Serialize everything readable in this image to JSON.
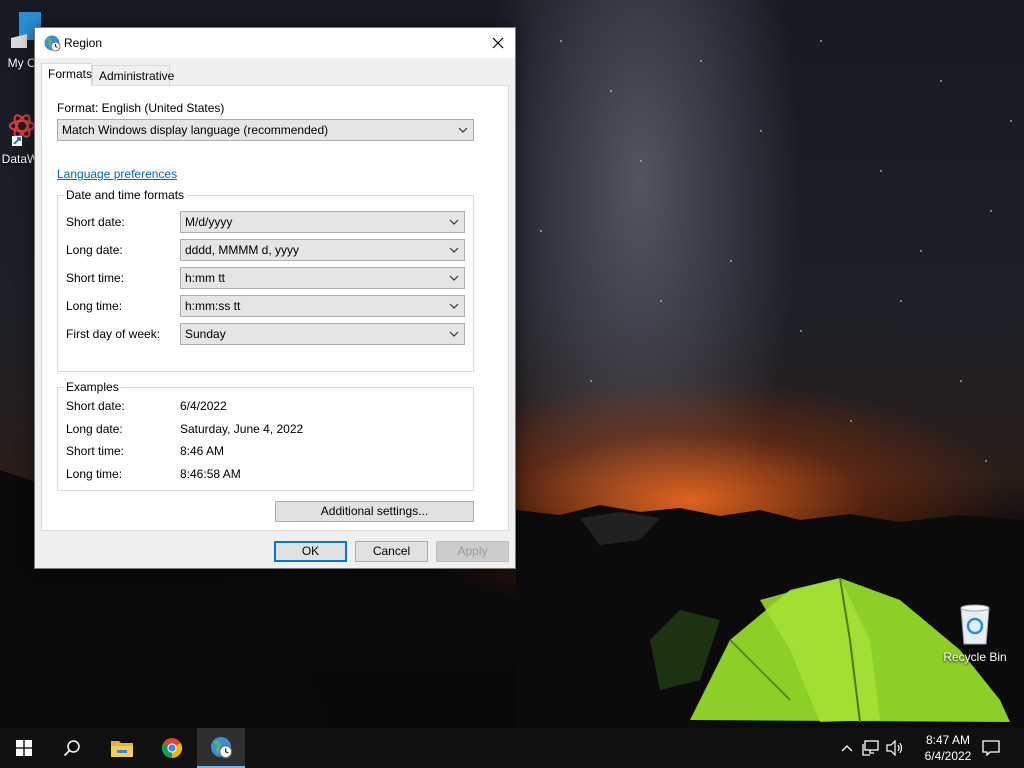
{
  "desktop": {
    "icons": [
      {
        "label": "My Co"
      },
      {
        "label": "DataW"
      },
      {
        "label": "Recycle Bin"
      }
    ]
  },
  "dialog": {
    "title": "Region",
    "tabs": [
      {
        "label": "Formats",
        "active": true
      },
      {
        "label": "Administrative",
        "active": false
      }
    ],
    "format_label": "Format: English (United States)",
    "format_value": "Match Windows display language (recommended)",
    "language_link": "Language preferences",
    "datetime_group": {
      "title": "Date and time formats",
      "rows": [
        {
          "label": "Short date:",
          "value": "M/d/yyyy"
        },
        {
          "label": "Long date:",
          "value": "dddd, MMMM d, yyyy"
        },
        {
          "label": "Short time:",
          "value": "h:mm tt"
        },
        {
          "label": "Long time:",
          "value": "h:mm:ss tt"
        },
        {
          "label": "First day of week:",
          "value": "Sunday"
        }
      ]
    },
    "examples_group": {
      "title": "Examples",
      "rows": [
        {
          "label": "Short date:",
          "value": "6/4/2022"
        },
        {
          "label": "Long date:",
          "value": "Saturday, June 4, 2022"
        },
        {
          "label": "Short time:",
          "value": "8:46 AM"
        },
        {
          "label": "Long time:",
          "value": "8:46:58 AM"
        }
      ]
    },
    "additional_settings": "Additional settings...",
    "ok": "OK",
    "cancel": "Cancel",
    "apply": "Apply"
  },
  "taskbar": {
    "time": "8:47 AM",
    "date": "6/4/2022",
    "accent": "#76b9ed"
  }
}
